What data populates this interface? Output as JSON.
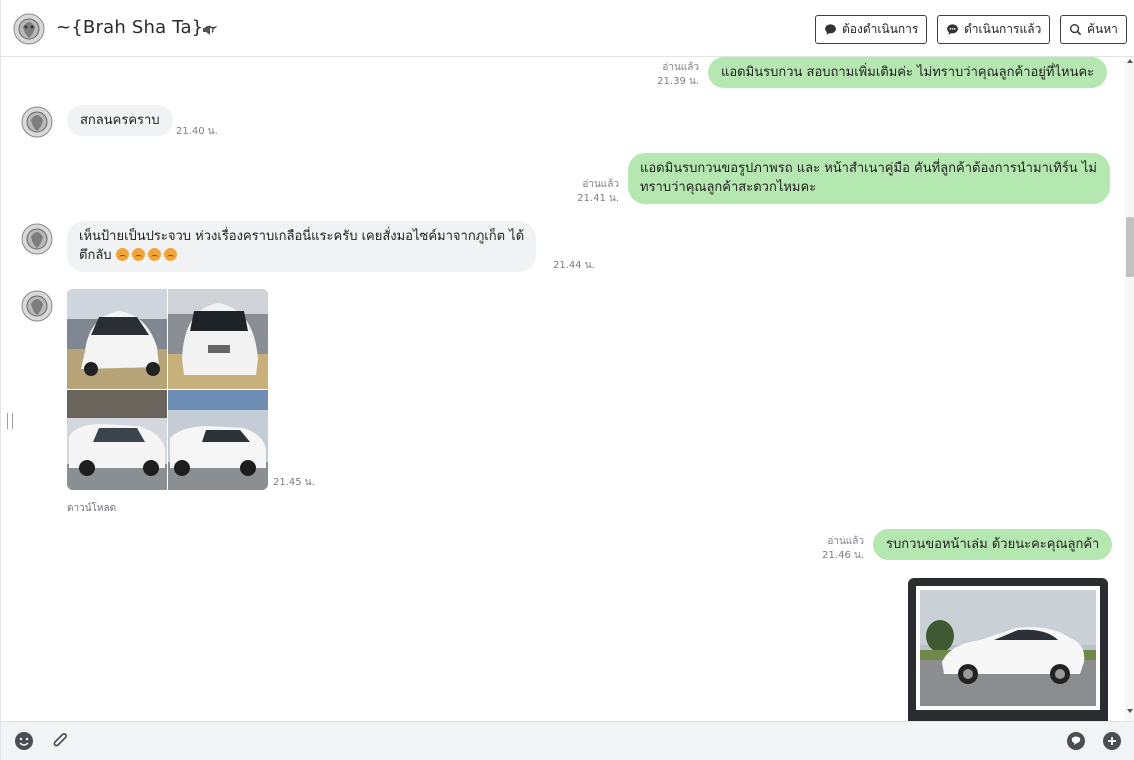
{
  "header": {
    "contact_name": "~{Brah Sha Ta}~",
    "buttons": {
      "todo": "ต้องดำเนินการ",
      "done": "ดำเนินการแล้ว",
      "search": "ค้นหา"
    }
  },
  "messages": [
    {
      "direction": "out",
      "text": "แอดมินรบกวน สอบถามเพิ่มเติมค่ะ ไม่ทราบว่าคุณลูกค้าอยู่ที่ไหนคะ",
      "read": "อ่านแล้ว",
      "time": "21.39 น."
    },
    {
      "direction": "in",
      "text": "สกลนครคราบ",
      "time": "21.40 น."
    },
    {
      "direction": "out",
      "line1": "แอดมินรบกวนขอรูปภาพรถ และ หน้าสำเนาคู่มือ คันที่ลูกค้าต้องการนำมาเทิร์น ไม่",
      "line2": "ทราบว่าคุณลูกค้าสะดวกไหมคะ",
      "read": "อ่านแล้ว",
      "time": "21.41 น."
    },
    {
      "direction": "in",
      "line1": "เห็นป้ายเป็นประจวบ ห่วงเรื่องคราบเกลือนี่แระครับ เคยสั่งมอไซค์มาจากภูเก็ต ได้",
      "line2": "ตึกลับ",
      "time": "21.44 น."
    },
    {
      "direction": "in",
      "type": "image-set",
      "download_label": "ดาวน์โหลด",
      "time": "21.45 น."
    },
    {
      "direction": "out",
      "text": "รบกวนขอหน้าเล่ม ด้วยนะคะคุณลูกค้า",
      "read": "อ่านแล้ว",
      "time": "21.46 น."
    },
    {
      "direction": "out",
      "type": "image"
    }
  ],
  "colors": {
    "outgoing_bubble": "#b5e8b0",
    "incoming_bubble": "#f1f2f4",
    "border": "#3b3f45"
  },
  "icons": {
    "mute": "speaker-icon",
    "emoji": "smiley-icon",
    "attach": "paperclip-icon",
    "sticker": "chat-bubble-icon",
    "add": "plus-icon"
  }
}
